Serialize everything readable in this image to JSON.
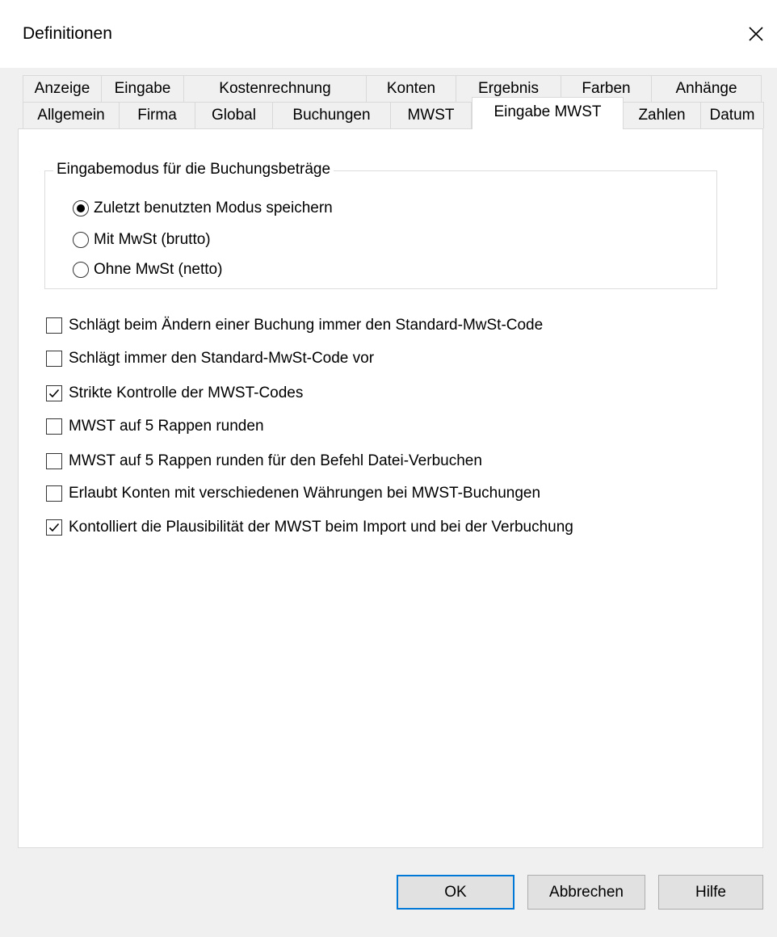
{
  "window": {
    "title": "Definitionen"
  },
  "tabs": {
    "row1": [
      "Anzeige",
      "Eingabe",
      "Kostenrechnung",
      "Konten",
      "Ergebnis",
      "Farben",
      "Anhänge"
    ],
    "row2": [
      "Allgemein",
      "Firma",
      "Global",
      "Buchungen",
      "MWST",
      "Eingabe MWST",
      "Zahlen",
      "Datum"
    ],
    "active": "Eingabe MWST"
  },
  "group": {
    "legend": "Eingabemodus für die Buchungsbeträge",
    "options": [
      {
        "label": "Zuletzt benutzten Modus speichern",
        "checked": true
      },
      {
        "label": "Mit MwSt (brutto)",
        "checked": false
      },
      {
        "label": "Ohne MwSt (netto)",
        "checked": false
      }
    ]
  },
  "checkboxes": [
    {
      "label": "Schlägt beim Ändern einer Buchung immer den Standard-MwSt-Code",
      "checked": false
    },
    {
      "label": "Schlägt immer den Standard-MwSt-Code vor",
      "checked": false
    },
    {
      "label": "Strikte Kontrolle der MWST-Codes",
      "checked": true
    },
    {
      "label": "MWST auf 5 Rappen runden",
      "checked": false
    },
    {
      "label": "MWST auf 5 Rappen runden für den Befehl Datei-Verbuchen",
      "checked": false
    },
    {
      "label": "Erlaubt Konten mit verschiedenen Währungen bei MWST-Buchungen",
      "checked": false
    },
    {
      "label": "Kontolliert die Plausibilität der MWST beim Import und bei der Verbuchung",
      "checked": true
    }
  ],
  "buttons": {
    "ok": "OK",
    "cancel": "Abbrechen",
    "help": "Hilfe"
  },
  "colors": {
    "accent": "#0078d7",
    "background": "#f0f0f0"
  }
}
